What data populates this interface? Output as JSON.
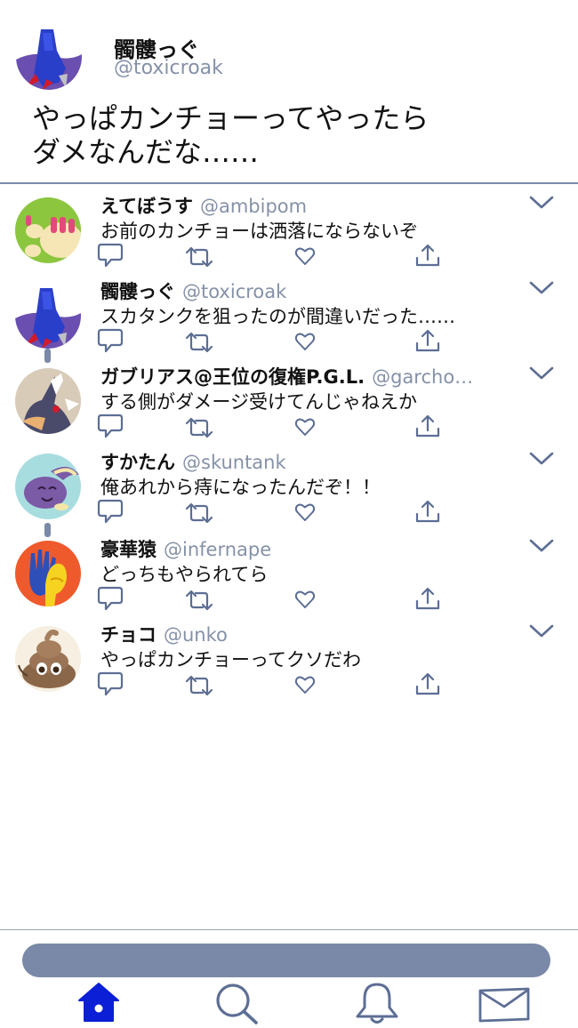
{
  "main_tweet": {
    "name": "髑髏っぐ",
    "handle": "@toxicroak",
    "text": "やっぱカンチョーってやったら\nダメなんだな……"
  },
  "replies": [
    {
      "name": "えてぼうす",
      "handle": "@ambipom",
      "text": "お前のカンチョーは洒落にならないぞ"
    },
    {
      "name": "髑髏っぐ",
      "handle": "@toxicroak",
      "text": "スカタンクを狙ったのが間違いだった……"
    },
    {
      "name": "ガブリアス@王位の復権P.G.L.",
      "handle": "@garcho…",
      "text": "する側がダメージ受けてんじゃねえか"
    },
    {
      "name": "すかたん",
      "handle": "@skuntank",
      "text": "俺あれから痔になったんだぞ！！"
    },
    {
      "name": "豪華猿",
      "handle": "@infernape",
      "text": "どっちもやられてら"
    },
    {
      "name": "チョコ",
      "handle": "@unko",
      "text": "やっぱカンチョーってクソだわ"
    }
  ],
  "icons": {
    "reply": "reply-icon",
    "retweet": "retweet-icon",
    "like": "heart-icon",
    "share": "share-icon",
    "more": "chevron-down-icon",
    "nav": [
      "home-icon",
      "search-icon",
      "bell-icon",
      "mail-icon"
    ]
  },
  "colors": {
    "accent": "#0a1fd6",
    "icon": "#5d6e94",
    "handle": "#8591a8",
    "divider": "#7a89a7"
  }
}
